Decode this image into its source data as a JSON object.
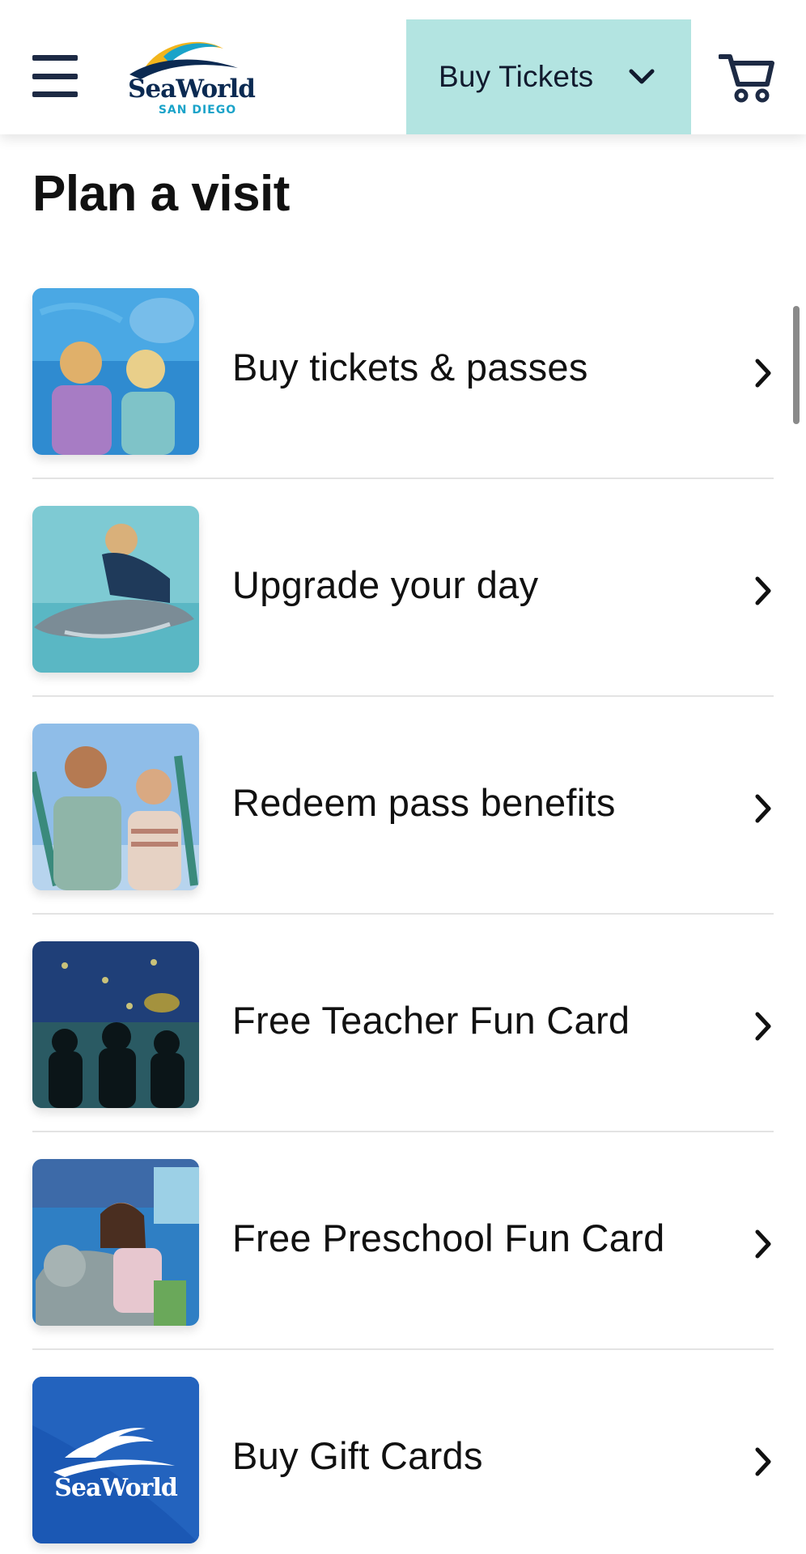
{
  "header": {
    "menu_icon": "hamburger-menu-icon",
    "logo": {
      "brand": "SeaWorld",
      "location": "SAN DIEGO"
    },
    "buy_button": {
      "label": "Buy Tickets",
      "icon": "chevron-down-icon",
      "background": "#b3e4e1"
    },
    "cart_icon": "shopping-cart-icon"
  },
  "main": {
    "title": "Plan a visit",
    "items": [
      {
        "label": "Buy tickets & passes",
        "image": "family-at-aquarium-photo"
      },
      {
        "label": "Upgrade your day",
        "image": "trainer-with-dolphin-photo"
      },
      {
        "label": "Redeem pass benefits",
        "image": "couple-with-passes-photo"
      },
      {
        "label": "Free Teacher Fun Card",
        "image": "silhouettes-at-aquarium-photo"
      },
      {
        "label": "Free Preschool Fun Card",
        "image": "girl-hugging-sea-lion-photo"
      },
      {
        "label": "Buy Gift Cards",
        "image": "seaworld-gift-card-image",
        "card_text": "SeaWorld"
      }
    ]
  },
  "colors": {
    "accent": "#b3e4e1",
    "navy": "#1d2a44",
    "text": "#111111",
    "divider": "#e3e3e3"
  }
}
